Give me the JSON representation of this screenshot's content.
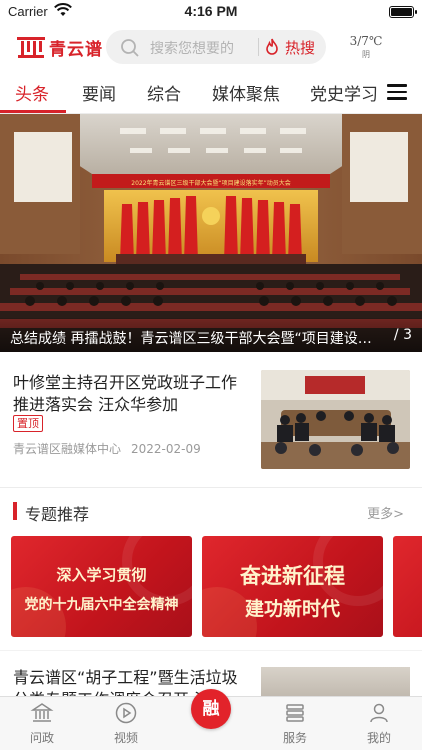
{
  "status_bar": {
    "carrier": "Carrier",
    "time": "4:16 PM"
  },
  "header": {
    "logo_text": "青云谱",
    "search_placeholder": "搜索您想要的",
    "hot_label": "热搜",
    "weather_temp": "3/7℃",
    "weather_condition": "阴"
  },
  "tabs": [
    {
      "label": "头条",
      "active": true
    },
    {
      "label": "要闻",
      "active": false
    },
    {
      "label": "综合",
      "active": false
    },
    {
      "label": "媒体聚焦",
      "active": false
    },
    {
      "label": "党史学习",
      "active": false
    }
  ],
  "banner": {
    "caption": "总结成绩 再擂战鼓！青云谱区三级干部大会暨“项目建设落实年”动员大会召开",
    "pager": "/ 3",
    "stage_banner": "2022年青云谱区三级干部大会暨“项目建设落实年”动员大会"
  },
  "news": [
    {
      "title": "叶修堂主持召开区党政班子工作推进落实会 汪众华参加",
      "badge": "置顶",
      "source": "青云谱区融媒体中心",
      "date": "2022-02-09"
    },
    {
      "title": "青云谱区“胡子工程”暨生活垃圾分类专题工作调度会召开 汪"
    }
  ],
  "topics_section": {
    "title": "专题推荐",
    "more": "更多>",
    "cards": [
      {
        "line1": "深入学习贯彻",
        "line2": "党的十九届六中全会精神"
      },
      {
        "line1": "奋进新征程",
        "line2": "建功新时代"
      }
    ]
  },
  "bottom_nav": [
    {
      "label": "问政",
      "icon": "bank-icon"
    },
    {
      "label": "视频",
      "icon": "play-icon"
    },
    {
      "label": "融",
      "icon": "center-logo"
    },
    {
      "label": "服务",
      "icon": "list-icon"
    },
    {
      "label": "我的",
      "icon": "user-icon"
    }
  ],
  "colors": {
    "accent": "#d8232a",
    "text": "#222222",
    "muted": "#9a9a9a"
  }
}
